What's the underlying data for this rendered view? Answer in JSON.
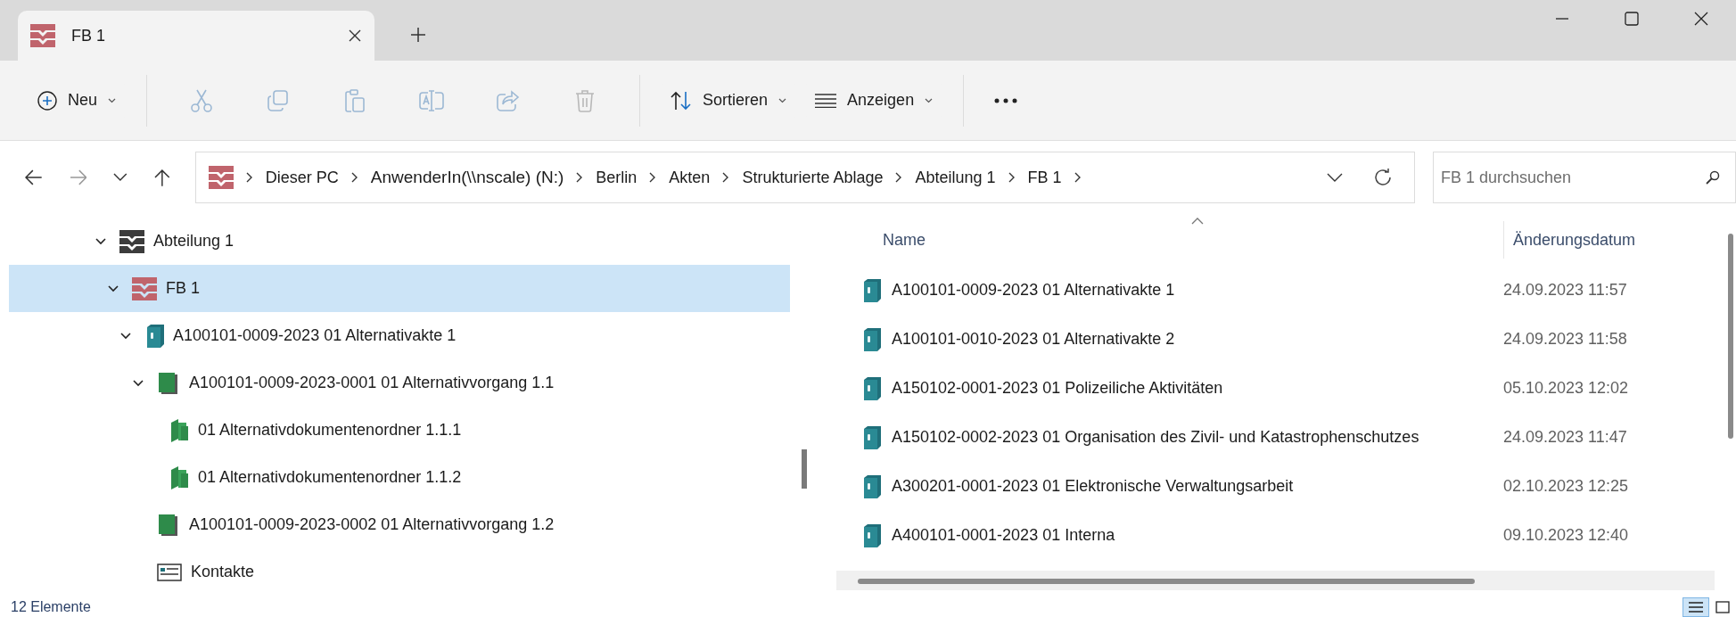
{
  "tabs": [
    {
      "label": "FB 1",
      "selected": true
    }
  ],
  "toolbar": {
    "new": "Neu",
    "actions": [
      {
        "kind": "cut",
        "disabled": true
      },
      {
        "kind": "copy",
        "disabled": true
      },
      {
        "kind": "paste",
        "disabled": true
      },
      {
        "kind": "rename",
        "disabled": true
      },
      {
        "kind": "share",
        "disabled": true
      },
      {
        "kind": "delete",
        "disabled": true
      }
    ],
    "sort": "Sortieren",
    "view": "Anzeigen"
  },
  "address": {
    "crumbs": [
      "Dieser PC",
      "AnwenderIn(\\\\nscale) (N:)",
      "Berlin",
      "Akten",
      "Strukturierte Ablage",
      "Abteilung 1",
      "FB 1"
    ]
  },
  "search": {
    "placeholder": "FB 1 durchsuchen"
  },
  "tree": [
    {
      "label": "Abteilung 1",
      "kind": "department",
      "expanded": true,
      "selected": false,
      "children": [
        {
          "label": "FB 1",
          "kind": "unit",
          "expanded": true,
          "selected": true,
          "children": [
            {
              "label": "A100101-0009-2023 01 Alternativakte 1",
              "kind": "file",
              "expanded": true,
              "selected": false,
              "children": [
                {
                  "label": "A100101-0009-2023-0001 01 Alternativvorgang 1.1",
                  "kind": "process",
                  "expanded": true,
                  "selected": false,
                  "children": [
                    {
                      "label": "01 Alternativdokumentenordner 1.1.1",
                      "kind": "folder",
                      "selected": false
                    },
                    {
                      "label": "01 Alternativdokumentenordner 1.1.2",
                      "kind": "folder",
                      "selected": false
                    }
                  ]
                },
                {
                  "label": "A100101-0009-2023-0002 01 Alternativvorgang 1.2",
                  "kind": "process",
                  "selected": false
                },
                {
                  "label": "Kontakte",
                  "kind": "contacts",
                  "selected": false
                }
              ]
            }
          ]
        }
      ]
    }
  ],
  "table": {
    "columns": [
      "Name",
      "Änderungsdatum"
    ],
    "rows": [
      {
        "name": "A100101-0009-2023 01 Alternativakte 1",
        "date": "24.09.2023 11:57"
      },
      {
        "name": "A100101-0010-2023 01 Alternativakte 2",
        "date": "24.09.2023 11:58"
      },
      {
        "name": "A150102-0001-2023 01 Polizeiliche Aktivitäten",
        "date": "05.10.2023 12:02"
      },
      {
        "name": "A150102-0002-2023 01 Organisation des Zivil- und Katastrophenschutzes",
        "date": "24.09.2023 11:47"
      },
      {
        "name": "A300201-0001-2023 01 Elektronische Verwaltungsarbeit",
        "date": "02.10.2023 12:25"
      },
      {
        "name": "A400101-0001-2023 01 Interna",
        "date": "09.10.2023 12:40"
      }
    ]
  },
  "status_bar": {
    "count": "12 Elemente",
    "views": [
      {
        "kind": "details",
        "selected": true
      },
      {
        "kind": "tiles",
        "selected": false
      }
    ]
  }
}
